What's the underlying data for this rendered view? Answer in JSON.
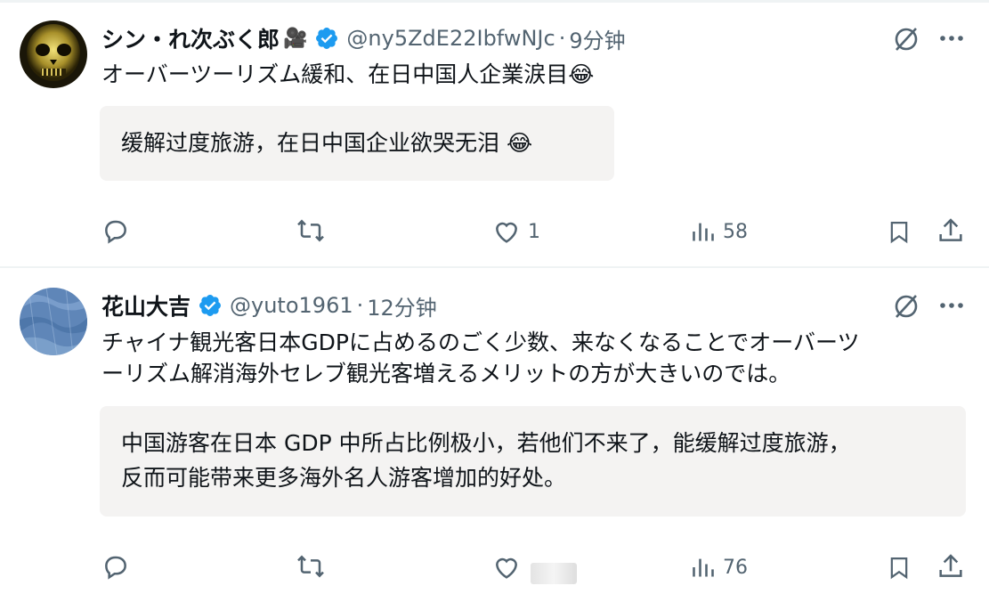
{
  "tweets": [
    {
      "display_name": "シン・れ次ぶく郎",
      "name_emoji": "🎥",
      "handle": "@ny5ZdE22IbfwNJc",
      "separator": "·",
      "time": "9分钟",
      "text": "オーバーツーリズム緩和、在日中国人企業涙目😂",
      "translation": "缓解过度旅游，在日中国企业欲哭无泪 😂",
      "likes": "1",
      "views": "58"
    },
    {
      "display_name": "花山大吉",
      "name_emoji": "",
      "handle": "@yuto1961",
      "separator": "·",
      "time": "12分钟",
      "text_line1": "チャイナ観光客日本GDPに占めるのごく少数、来なくなることでオーバーツ",
      "text_line2": "ーリズム解消海外セレブ観光客増えるメリットの方が大きいのでは。",
      "translation_line1": "中国游客在日本 GDP 中所占比例极小，若他们不来了，能缓解过度旅游，",
      "translation_line2": "反而可能带来更多海外名人游客增加的好处。",
      "likes": "",
      "views": "76"
    }
  ],
  "colors": {
    "verified": "#1d9bf0",
    "icon": "#536471",
    "text": "#0f1419",
    "translation_bg": "#f4f3f2"
  },
  "icons": [
    "grok-icon",
    "more-icon",
    "reply-icon",
    "retweet-icon",
    "like-icon",
    "views-icon",
    "bookmark-icon",
    "share-icon",
    "verified-badge-icon"
  ]
}
